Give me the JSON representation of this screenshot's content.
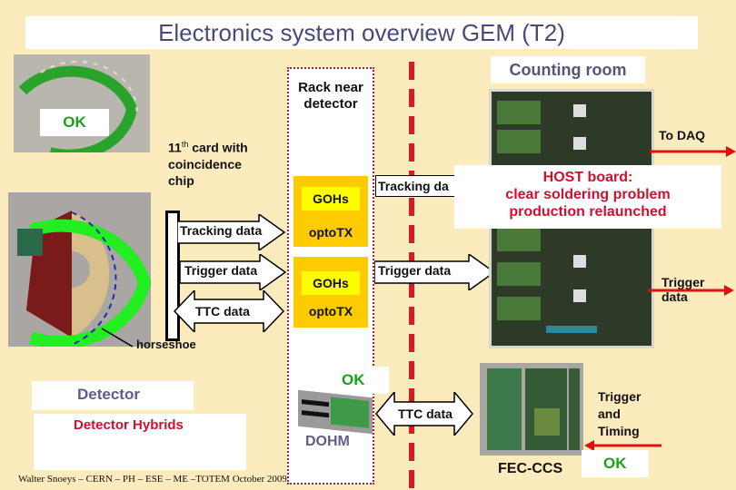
{
  "title": "Electronics system overview GEM (T2)",
  "counting_room": "Counting room",
  "rack": {
    "title_line1": "Rack near",
    "title_line2": "detector",
    "blocks": [
      {
        "goh": "GOHs",
        "opto": "optoTX"
      },
      {
        "goh": "GOHs",
        "opto": "optoTX"
      }
    ]
  },
  "detector_side": {
    "ok_label": "OK",
    "card_note_line1_num": "11",
    "card_note_line1_sup": "th",
    "card_note_line1_rest": " card with",
    "card_note_line2": "coincidence",
    "card_note_line3": "chip",
    "horseshoe": "horseshoe",
    "detector": "Detector",
    "detector_hybrids": "Detector Hybrids"
  },
  "arrows": {
    "tracking_left": "Tracking data",
    "trigger_left": "Trigger data",
    "ttc_left": "TTC data",
    "tracking_right": "Tracking da",
    "trigger_right": "Trigger data",
    "ttc_bottom": "TTC data",
    "to_daq": "To DAQ",
    "trigger_out_line1": "Trigger",
    "trigger_out_line2": "data",
    "trigger_timing_line1": "Trigger",
    "trigger_timing_line2": "and",
    "trigger_timing_line3": "Timing"
  },
  "host_note": {
    "line1": "HOST board:",
    "line2": "clear soldering problem",
    "line3": "production relaunched"
  },
  "dohm": {
    "ok": "OK",
    "label": "DOHM"
  },
  "fec": {
    "label": "FEC-CCS",
    "ok": "OK"
  },
  "footer": "Walter Snoeys – CERN – PH – ESE – ME –TOTEM October 2009",
  "colors": {
    "background": "#fcebbd",
    "ok_green": "#1aa31a",
    "alert_red": "#d0102e",
    "goh_orange": "#fecb00",
    "goh_yellow": "#fffc00",
    "divider_red": "#d11f24"
  }
}
